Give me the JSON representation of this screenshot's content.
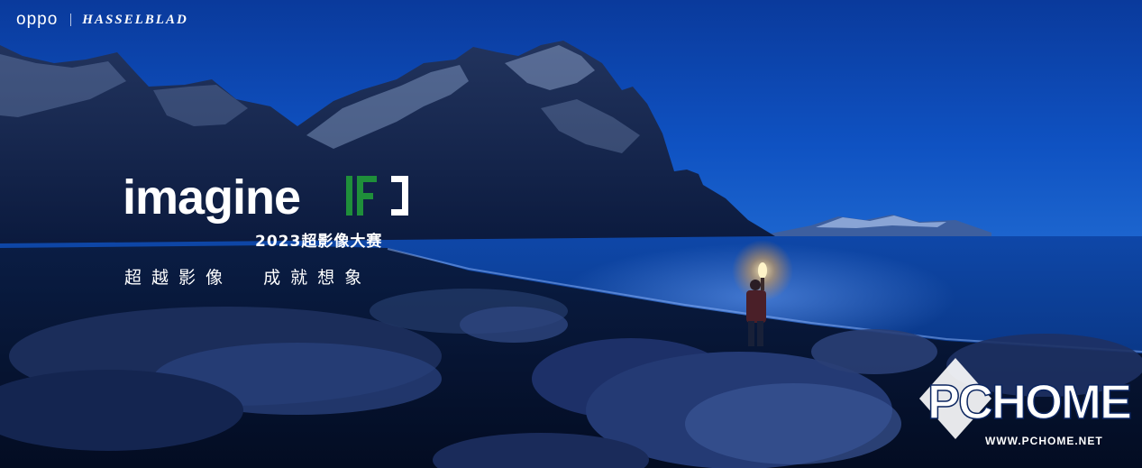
{
  "brand": {
    "oppo": "oppo",
    "hasselblad": "HASSELBLAD"
  },
  "hero": {
    "wordmark": "imagine",
    "contest": "2023超影像大赛",
    "slogan": "超越影像  成就想象",
    "if_color": "#1f8f3a"
  },
  "watermark": {
    "logo_text": "PCHOME",
    "url": "WWW.PCHOME.NET"
  },
  "colors": {
    "sky": "#0a3fa0",
    "sea": "#0c3f9a",
    "ground": "#061634",
    "torch": "#ffb040"
  }
}
